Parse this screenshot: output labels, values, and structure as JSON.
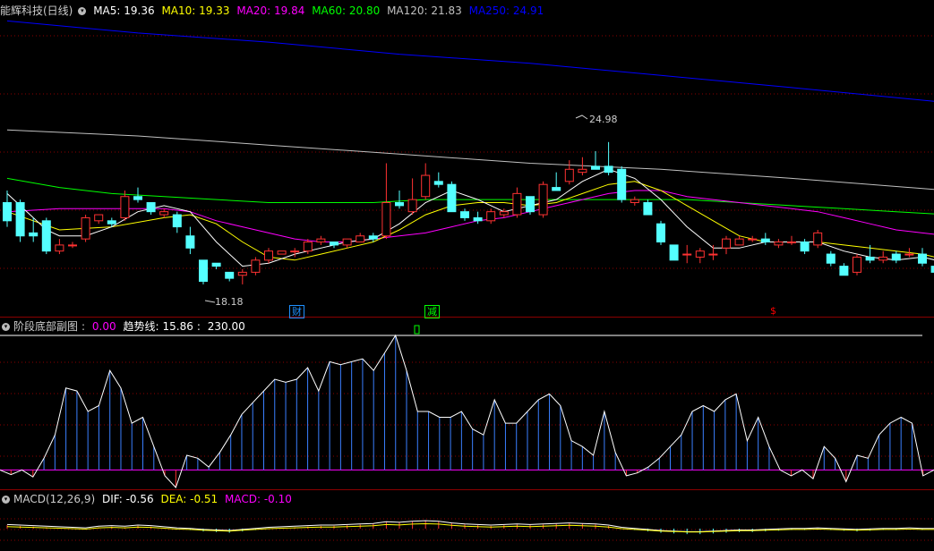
{
  "main_header": {
    "stock_title": "能辉科技(日线)",
    "ma": [
      {
        "text": "MA5: 19.36",
        "color": "#ffffff"
      },
      {
        "text": "MA10: 19.33",
        "color": "#ffff00"
      },
      {
        "text": "MA20: 19.84",
        "color": "#ff00ff"
      },
      {
        "text": "MA60: 20.80",
        "color": "#00ff00"
      },
      {
        "text": "MA120: 21.83",
        "color": "#c0c0c0"
      },
      {
        "text": "MA250: 24.91",
        "color": "#0000ff"
      }
    ]
  },
  "price_labels": {
    "high": "24.98",
    "low": "18.18"
  },
  "event_markers": [
    {
      "text": "财",
      "color": "#1e90ff"
    },
    {
      "text": "减",
      "color": "#00ff00"
    },
    {
      "text": "$",
      "color": "#ff0000"
    }
  ],
  "sub1_header": {
    "name": "阶段底部副图",
    "value1": "0.00",
    "label2": "趋势线:",
    "value2": "15.86",
    "value3": "230.00"
  },
  "sub2_header": {
    "name": "MACD(12,26,9)",
    "dif": "DIF: -0.56",
    "dea": "DEA: -0.51",
    "macd": "MACD: -0.10"
  },
  "colors": {
    "up": "#ff3232",
    "down": "#54ffff",
    "ma5": "#ffffff",
    "ma10": "#ffff00",
    "ma20": "#ff00ff",
    "ma60": "#00ff00",
    "ma120": "#c0c0c0",
    "ma250": "#0000ff",
    "grid": "#8b0000"
  },
  "chart_data": {
    "type": "candlestick",
    "price_range": [
      17.4,
      27.0
    ],
    "candles": [
      [
        20.9,
        21.3,
        20.1,
        20.3
      ],
      [
        20.9,
        21.0,
        19.6,
        19.8
      ],
      [
        19.9,
        20.4,
        19.6,
        19.8
      ],
      [
        20.3,
        20.4,
        19.2,
        19.3
      ],
      [
        19.3,
        19.7,
        19.2,
        19.5
      ],
      [
        19.5,
        19.6,
        19.4,
        19.5
      ],
      [
        19.7,
        20.5,
        19.6,
        20.4
      ],
      [
        20.3,
        20.5,
        20.2,
        20.5
      ],
      [
        20.3,
        20.4,
        20.1,
        20.2
      ],
      [
        20.4,
        21.3,
        20.3,
        21.1
      ],
      [
        21.1,
        21.4,
        20.9,
        21.0
      ],
      [
        20.9,
        20.9,
        20.5,
        20.6
      ],
      [
        20.5,
        20.7,
        20.4,
        20.6
      ],
      [
        20.5,
        20.6,
        19.9,
        20.1
      ],
      [
        19.8,
        20.1,
        19.2,
        19.4
      ],
      [
        19.0,
        19.0,
        18.2,
        18.3
      ],
      [
        18.9,
        18.9,
        18.7,
        18.8
      ],
      [
        18.6,
        18.6,
        18.3,
        18.4
      ],
      [
        18.5,
        18.7,
        18.2,
        18.6
      ],
      [
        18.6,
        19.1,
        18.5,
        19.0
      ],
      [
        19.0,
        19.4,
        18.9,
        19.3
      ],
      [
        19.2,
        19.3,
        19.2,
        19.3
      ],
      [
        19.3,
        19.4,
        19.1,
        19.3
      ],
      [
        19.3,
        19.7,
        19.2,
        19.6
      ],
      [
        19.6,
        19.8,
        19.5,
        19.7
      ],
      [
        19.6,
        19.6,
        19.4,
        19.5
      ],
      [
        19.5,
        19.7,
        19.4,
        19.7
      ],
      [
        19.6,
        19.9,
        19.6,
        19.8
      ],
      [
        19.8,
        19.9,
        19.6,
        19.7
      ],
      [
        19.8,
        22.2,
        19.7,
        20.9
      ],
      [
        20.9,
        21.3,
        20.7,
        20.8
      ],
      [
        20.6,
        21.7,
        20.5,
        21.0
      ],
      [
        21.1,
        22.2,
        21.0,
        21.8
      ],
      [
        21.6,
        21.9,
        21.4,
        21.5
      ],
      [
        21.5,
        21.6,
        20.6,
        20.6
      ],
      [
        20.6,
        20.7,
        20.3,
        20.4
      ],
      [
        20.4,
        20.6,
        20.2,
        20.3
      ],
      [
        20.3,
        20.7,
        20.2,
        20.6
      ],
      [
        20.5,
        20.7,
        20.4,
        20.6
      ],
      [
        20.5,
        21.4,
        20.4,
        21.2
      ],
      [
        21.1,
        21.1,
        20.5,
        20.6
      ],
      [
        20.5,
        21.6,
        20.4,
        21.5
      ],
      [
        21.4,
        21.9,
        21.3,
        21.3
      ],
      [
        21.6,
        22.3,
        21.5,
        22.0
      ],
      [
        21.9,
        22.4,
        21.8,
        22.0
      ],
      [
        22.1,
        22.6,
        22.0,
        22.0
      ],
      [
        22.1,
        22.9,
        21.8,
        21.9
      ],
      [
        22.0,
        22.1,
        20.9,
        21.0
      ],
      [
        20.9,
        21.1,
        20.8,
        21.0
      ],
      [
        20.9,
        21.0,
        20.5,
        20.5
      ],
      [
        20.2,
        20.3,
        19.5,
        19.6
      ],
      [
        19.5,
        19.5,
        19.0,
        19.0
      ],
      [
        19.2,
        19.5,
        18.9,
        19.2
      ],
      [
        19.1,
        19.4,
        18.9,
        19.3
      ],
      [
        19.2,
        19.5,
        19.0,
        19.2
      ],
      [
        19.4,
        19.8,
        19.2,
        19.7
      ],
      [
        19.5,
        19.8,
        19.5,
        19.7
      ],
      [
        19.7,
        19.8,
        19.6,
        19.7
      ],
      [
        19.7,
        19.9,
        19.5,
        19.6
      ],
      [
        19.5,
        19.7,
        19.4,
        19.6
      ],
      [
        19.6,
        19.8,
        19.5,
        19.6
      ],
      [
        19.6,
        19.7,
        19.2,
        19.3
      ],
      [
        19.5,
        20.0,
        19.4,
        19.9
      ],
      [
        19.2,
        19.3,
        18.8,
        18.9
      ],
      [
        18.8,
        18.9,
        18.5,
        18.5
      ],
      [
        18.6,
        19.2,
        18.5,
        19.1
      ],
      [
        19.1,
        19.5,
        18.9,
        19.0
      ],
      [
        19.0,
        19.3,
        18.9,
        19.1
      ],
      [
        19.2,
        19.3,
        18.9,
        19.0
      ],
      [
        19.2,
        19.4,
        19.1,
        19.2
      ],
      [
        19.2,
        19.4,
        18.8,
        18.9
      ],
      [
        18.8,
        18.8,
        18.6,
        18.6
      ],
      [
        18.6,
        18.8,
        18.3,
        18.4
      ]
    ],
    "ma_points": {
      "ma5": [
        [
          0,
          21.2
        ],
        [
          1,
          20.8
        ],
        [
          2,
          20.4
        ],
        [
          3,
          20.0
        ],
        [
          4,
          19.8
        ],
        [
          6,
          19.8
        ],
        [
          8,
          20.1
        ],
        [
          10,
          20.6
        ],
        [
          12,
          20.8
        ],
        [
          14,
          20.6
        ],
        [
          16,
          19.6
        ],
        [
          18,
          18.8
        ],
        [
          20,
          18.9
        ],
        [
          22,
          19.2
        ],
        [
          24,
          19.4
        ],
        [
          26,
          19.6
        ],
        [
          28,
          19.7
        ],
        [
          30,
          20.2
        ],
        [
          32,
          20.9
        ],
        [
          34,
          21.3
        ],
        [
          36,
          21.0
        ],
        [
          38,
          20.6
        ],
        [
          40,
          20.8
        ],
        [
          42,
          21.0
        ],
        [
          44,
          21.6
        ],
        [
          46,
          22.0
        ],
        [
          48,
          21.7
        ],
        [
          50,
          21.0
        ],
        [
          52,
          20.1
        ],
        [
          54,
          19.4
        ],
        [
          56,
          19.4
        ],
        [
          58,
          19.6
        ],
        [
          60,
          19.6
        ],
        [
          62,
          19.6
        ],
        [
          64,
          19.3
        ],
        [
          66,
          19.1
        ],
        [
          68,
          19.0
        ],
        [
          70,
          19.1
        ],
        [
          72,
          18.9
        ]
      ],
      "ma10": [
        [
          0,
          20.6
        ],
        [
          4,
          20.0
        ],
        [
          8,
          20.1
        ],
        [
          12,
          20.4
        ],
        [
          14,
          20.5
        ],
        [
          16,
          20.2
        ],
        [
          18,
          19.6
        ],
        [
          20,
          19.1
        ],
        [
          22,
          19.0
        ],
        [
          24,
          19.2
        ],
        [
          26,
          19.4
        ],
        [
          28,
          19.6
        ],
        [
          30,
          20.0
        ],
        [
          32,
          20.5
        ],
        [
          34,
          20.8
        ],
        [
          36,
          20.9
        ],
        [
          38,
          20.9
        ],
        [
          40,
          20.8
        ],
        [
          42,
          20.9
        ],
        [
          44,
          21.2
        ],
        [
          46,
          21.5
        ],
        [
          48,
          21.6
        ],
        [
          50,
          21.3
        ],
        [
          52,
          20.8
        ],
        [
          54,
          20.3
        ],
        [
          56,
          19.8
        ],
        [
          58,
          19.6
        ],
        [
          60,
          19.6
        ],
        [
          62,
          19.6
        ],
        [
          64,
          19.5
        ],
        [
          66,
          19.4
        ],
        [
          68,
          19.3
        ],
        [
          70,
          19.2
        ],
        [
          72,
          19.0
        ]
      ],
      "ma20": [
        [
          0,
          20.6
        ],
        [
          4,
          20.7
        ],
        [
          8,
          20.7
        ],
        [
          12,
          20.7
        ],
        [
          14,
          20.6
        ],
        [
          16,
          20.3
        ],
        [
          18,
          20.1
        ],
        [
          20,
          19.9
        ],
        [
          22,
          19.7
        ],
        [
          24,
          19.6
        ],
        [
          26,
          19.6
        ],
        [
          28,
          19.7
        ],
        [
          30,
          19.8
        ],
        [
          32,
          19.9
        ],
        [
          34,
          20.1
        ],
        [
          36,
          20.3
        ],
        [
          38,
          20.4
        ],
        [
          40,
          20.6
        ],
        [
          42,
          20.8
        ],
        [
          44,
          21.0
        ],
        [
          46,
          21.2
        ],
        [
          48,
          21.3
        ],
        [
          50,
          21.3
        ],
        [
          52,
          21.1
        ],
        [
          54,
          21.0
        ],
        [
          56,
          20.9
        ],
        [
          58,
          20.8
        ],
        [
          60,
          20.7
        ],
        [
          62,
          20.6
        ],
        [
          64,
          20.4
        ],
        [
          66,
          20.2
        ],
        [
          68,
          20.0
        ],
        [
          70,
          19.9
        ],
        [
          72,
          19.8
        ]
      ],
      "ma60": [
        [
          0,
          21.7
        ],
        [
          4,
          21.4
        ],
        [
          8,
          21.2
        ],
        [
          12,
          21.1
        ],
        [
          16,
          21.0
        ],
        [
          20,
          20.9
        ],
        [
          24,
          20.9
        ],
        [
          28,
          20.9
        ],
        [
          32,
          21.0
        ],
        [
          36,
          21.0
        ],
        [
          40,
          21.0
        ],
        [
          44,
          21.0
        ],
        [
          48,
          21.0
        ],
        [
          52,
          21.0
        ],
        [
          56,
          20.9
        ],
        [
          60,
          20.8
        ],
        [
          64,
          20.7
        ],
        [
          68,
          20.6
        ],
        [
          72,
          20.5
        ]
      ],
      "ma120": [
        [
          0,
          23.3
        ],
        [
          10,
          23.1
        ],
        [
          20,
          22.8
        ],
        [
          30,
          22.5
        ],
        [
          40,
          22.2
        ],
        [
          50,
          22.0
        ],
        [
          60,
          21.7
        ],
        [
          72,
          21.3
        ]
      ],
      "ma250": [
        [
          0,
          26.9
        ],
        [
          10,
          26.5
        ],
        [
          20,
          26.2
        ],
        [
          30,
          25.8
        ],
        [
          40,
          25.5
        ],
        [
          50,
          25.1
        ],
        [
          60,
          24.7
        ],
        [
          72,
          24.2
        ]
      ]
    },
    "subchart_range": [
      -30,
      230
    ],
    "bottom_values": [
      0,
      -8,
      0,
      -12,
      20,
      60,
      140,
      135,
      100,
      110,
      170,
      140,
      80,
      90,
      40,
      -10,
      -30,
      25,
      20,
      5,
      30,
      60,
      95,
      115,
      135,
      155,
      150,
      155,
      175,
      135,
      185,
      180,
      185,
      190,
      170,
      200,
      230,
      170,
      100,
      100,
      90,
      90,
      100,
      70,
      60,
      120,
      80,
      80,
      100,
      120,
      130,
      110,
      50,
      40,
      25,
      100,
      30,
      -10,
      -5,
      5,
      20,
      40,
      60,
      100,
      110,
      100,
      120,
      130,
      50,
      90,
      40,
      0,
      -10,
      0,
      -15,
      40,
      20,
      -20,
      25,
      20,
      60,
      80,
      90,
      80,
      -10,
      0
    ],
    "trend_line": 230,
    "macd_range": [
      -1.5,
      1.5
    ],
    "macd_hist": [
      0.25,
      0.2,
      0.15,
      0.1,
      0.05,
      0.0,
      -0.05,
      0.1,
      0.15,
      0.1,
      0.2,
      0.15,
      0.05,
      -0.05,
      -0.1,
      -0.2,
      -0.25,
      -0.3,
      -0.2,
      -0.1,
      0.0,
      0.05,
      0.1,
      0.15,
      0.2,
      0.2,
      0.25,
      0.3,
      0.35,
      0.5,
      0.45,
      0.55,
      0.6,
      0.55,
      0.4,
      0.3,
      0.25,
      0.2,
      0.25,
      0.3,
      0.25,
      0.3,
      0.35,
      0.4,
      0.35,
      0.3,
      0.2,
      0.0,
      -0.1,
      -0.2,
      -0.3,
      -0.35,
      -0.4,
      -0.4,
      -0.35,
      -0.3,
      -0.25,
      -0.25,
      -0.2,
      -0.15,
      -0.1,
      -0.1,
      -0.05,
      -0.1,
      -0.15,
      -0.2,
      -0.15,
      -0.1,
      -0.1,
      -0.05,
      -0.1,
      -0.1,
      -0.1
    ]
  }
}
